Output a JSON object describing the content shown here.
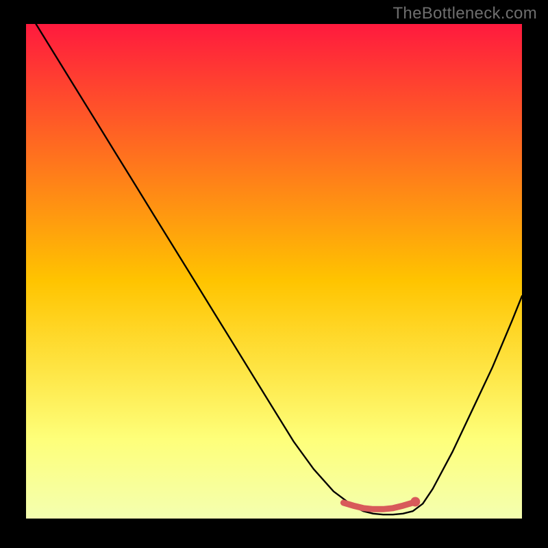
{
  "watermark": "TheBottleneck.com",
  "colors": {
    "background": "#000000",
    "gradient_top": "#ff1a3e",
    "gradient_mid": "#ffc400",
    "gradient_low": "#feff7a",
    "curve": "#000000",
    "marker_stroke": "#d85a5a",
    "marker_fill": "#d85a5a",
    "floor_gradient_top": "#f4ffb0",
    "floor_gradient_bottom": "#00e84f"
  },
  "chart_data": {
    "type": "line",
    "title": "",
    "xlabel": "",
    "ylabel": "",
    "xlim": [
      0,
      100
    ],
    "ylim": [
      0,
      100
    ],
    "x": [
      2,
      6,
      10,
      14,
      18,
      22,
      26,
      30,
      34,
      38,
      42,
      46,
      50,
      54,
      58,
      62,
      66,
      68,
      70,
      72,
      74,
      76,
      78,
      80,
      82,
      86,
      90,
      94,
      98,
      100
    ],
    "y": [
      100,
      93.5,
      87,
      80.5,
      74,
      67.5,
      61,
      54.5,
      48,
      41.5,
      35,
      28.5,
      22,
      15.5,
      10,
      5.5,
      2.5,
      1.5,
      1.0,
      0.8,
      0.8,
      1.0,
      1.5,
      3.0,
      6.0,
      13.5,
      22,
      30.5,
      40,
      45
    ],
    "marker_segment": {
      "x": [
        64,
        66,
        68,
        70,
        72,
        74,
        76,
        78
      ],
      "y": [
        3.2,
        2.6,
        2.1,
        1.9,
        1.9,
        2.1,
        2.6,
        3.2
      ]
    },
    "marker_dot": {
      "x": 78.5,
      "y": 3.4
    },
    "annotations": []
  },
  "floor_bands": 18
}
